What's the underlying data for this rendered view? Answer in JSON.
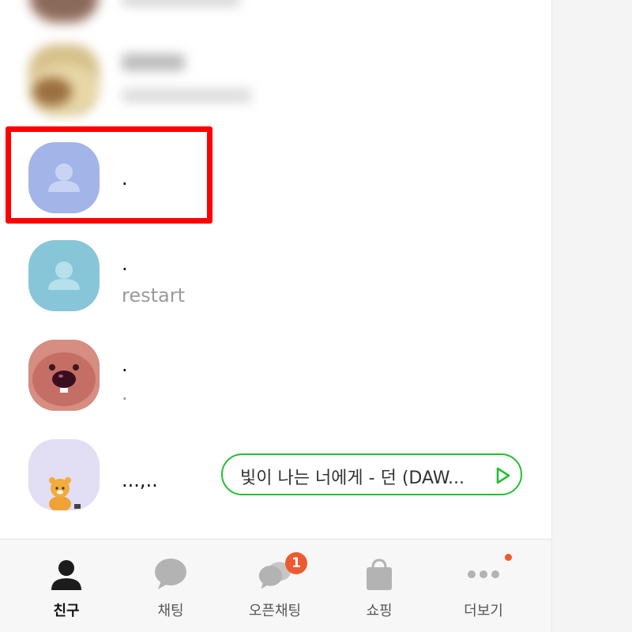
{
  "friends": [
    {
      "name": "",
      "status": "",
      "avatar": "photo-blurred"
    },
    {
      "name": "",
      "status": "",
      "avatar": "photo-blurred"
    },
    {
      "name": ".",
      "status": "",
      "avatar": "default-person-blue"
    },
    {
      "name": ".",
      "status": "restart",
      "avatar": "default-person-teal"
    },
    {
      "name": ".",
      "status": ".",
      "avatar": "beaver-character"
    },
    {
      "name": "...,..",
      "status": "",
      "avatar": "lion-character"
    }
  ],
  "music": {
    "text": "빛이 나는 너에게 - 던 (DAW..."
  },
  "tabs": [
    {
      "label": "친구",
      "icon": "person-icon",
      "active": true
    },
    {
      "label": "채팅",
      "icon": "chat-bubble-icon"
    },
    {
      "label": "오픈채팅",
      "icon": "open-chat-icon",
      "badge": "1"
    },
    {
      "label": "쇼핑",
      "icon": "shopping-bag-icon"
    },
    {
      "label": "더보기",
      "icon": "more-icon",
      "dot": true
    }
  ],
  "colors": {
    "highlight": "#ff0000",
    "music_border": "#22c034",
    "badge": "#ee5a2f"
  }
}
